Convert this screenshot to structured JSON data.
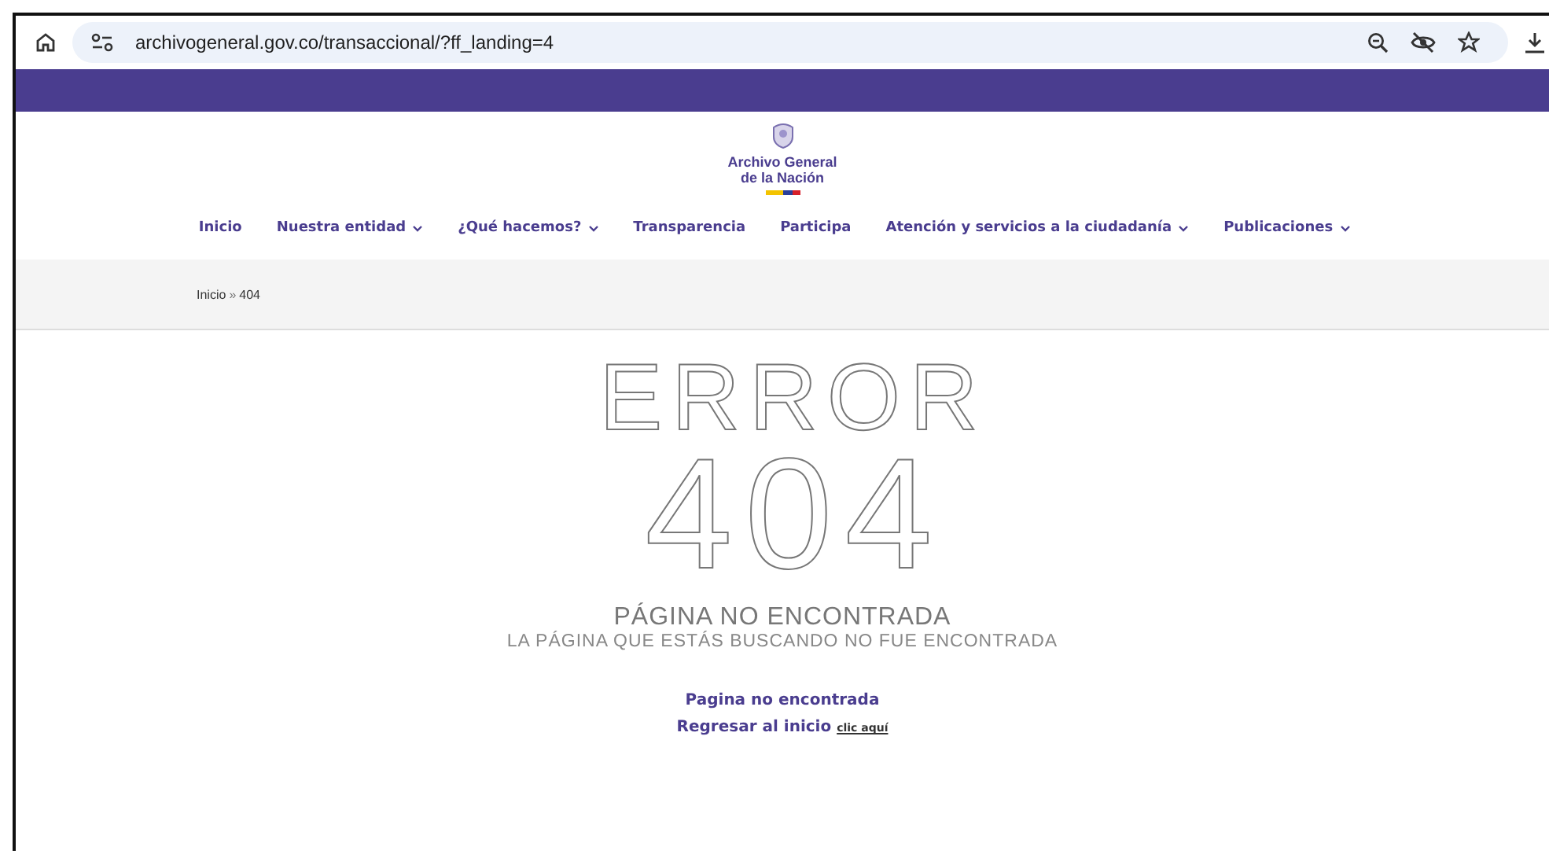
{
  "browser": {
    "url": "archivogeneral.gov.co/transaccional/?ff_landing=4"
  },
  "header": {
    "logo_line_1": "Archivo General",
    "logo_line_2": "de la Nación"
  },
  "nav": [
    {
      "label": "Inicio",
      "dropdown": false
    },
    {
      "label": "Nuestra entidad",
      "dropdown": true
    },
    {
      "label": "¿Qué hacemos?",
      "dropdown": true
    },
    {
      "label": "Transparencia",
      "dropdown": false
    },
    {
      "label": "Participa",
      "dropdown": false
    },
    {
      "label": "Atención y servicios a la ciudadanía",
      "dropdown": true
    },
    {
      "label": "Publicaciones",
      "dropdown": true
    }
  ],
  "breadcrumb": {
    "home": "Inicio",
    "separator": "»",
    "current": "404"
  },
  "error": {
    "title": "ERROR",
    "code": "404",
    "heading": "PÁGINA NO ENCONTRADA",
    "subheading": "LA PÁGINA QUE ESTÁS BUSCANDO NO FUE ENCONTRADA",
    "message": "Pagina no encontrada",
    "return_text": "Regresar al inicio",
    "return_link": "clic aquí"
  }
}
